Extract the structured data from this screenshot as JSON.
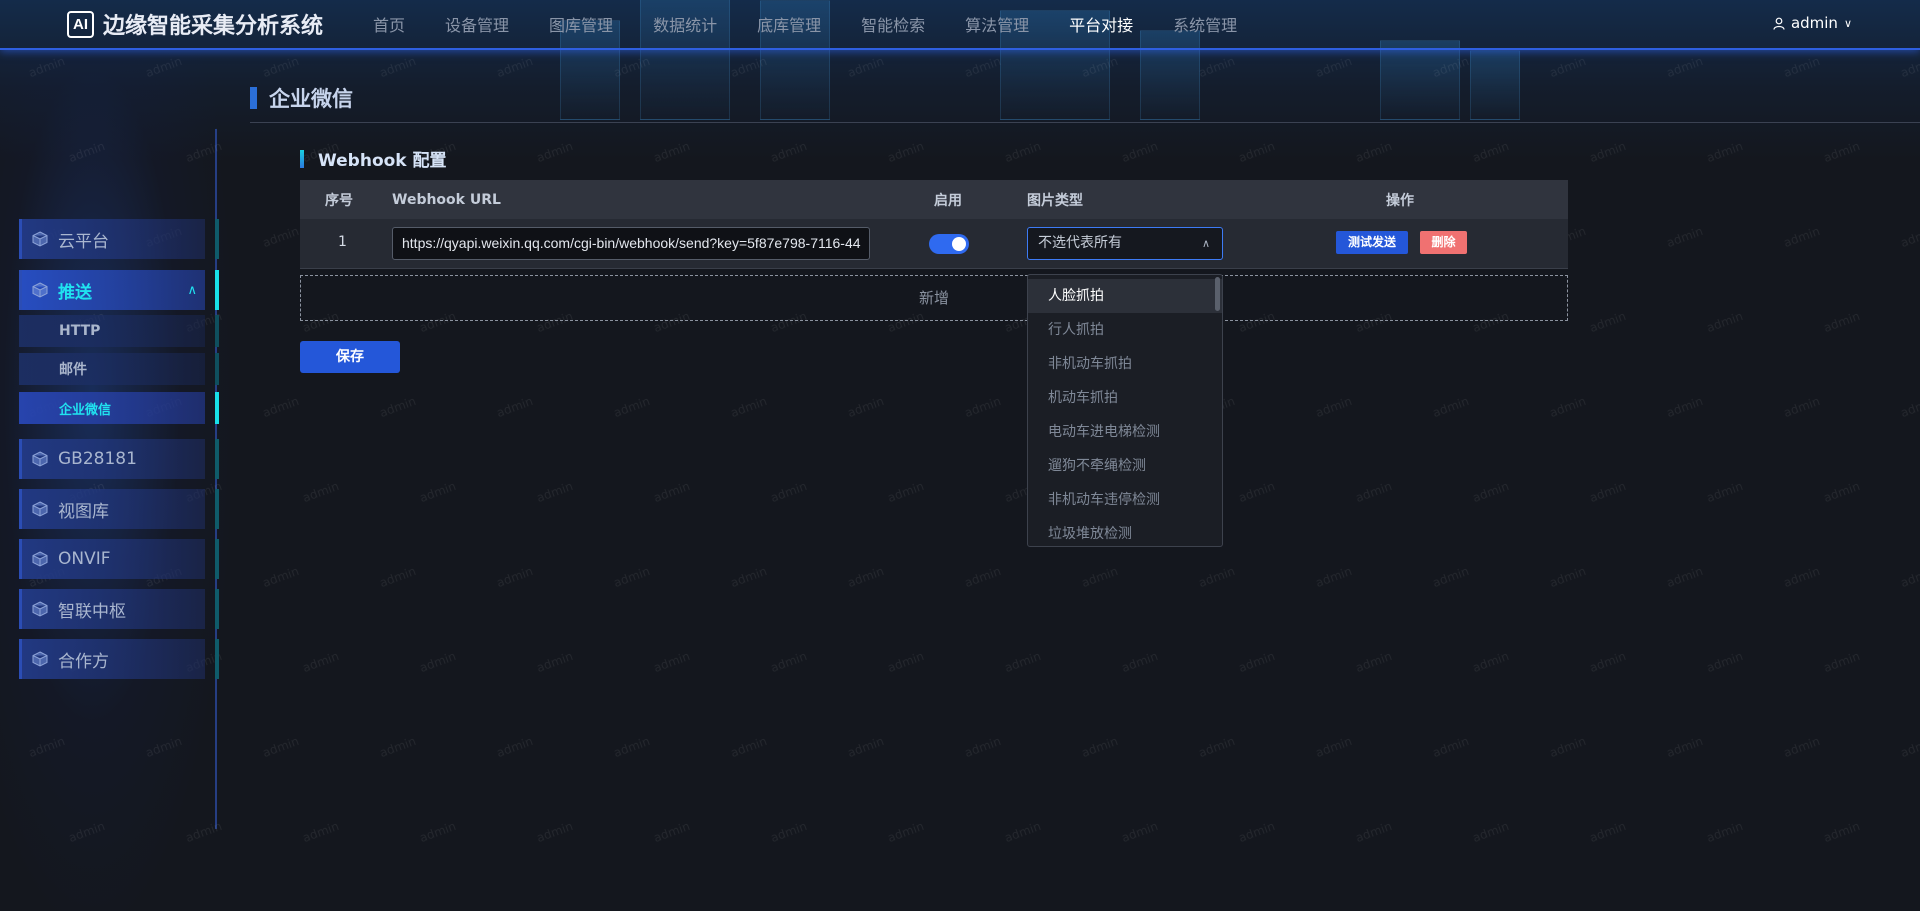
{
  "app": {
    "logo_text": "AI",
    "title": "边缘智能采集分析系统"
  },
  "nav": {
    "items": [
      "首页",
      "设备管理",
      "图库管理",
      "数据统计",
      "底库管理",
      "智能检索",
      "算法管理",
      "平台对接",
      "系统管理"
    ],
    "active": "平台对接"
  },
  "user": {
    "name": "admin"
  },
  "watermark": "admin",
  "sidebar": {
    "items": [
      {
        "label": "云平台"
      },
      {
        "label": "推送",
        "open": true
      },
      {
        "label": "GB28181"
      },
      {
        "label": "视图库"
      },
      {
        "label": "ONVIF"
      },
      {
        "label": "智联中枢"
      },
      {
        "label": "合作方"
      }
    ],
    "push_sub": [
      {
        "label": "HTTP"
      },
      {
        "label": "邮件"
      },
      {
        "label": "企业微信",
        "active": true
      }
    ]
  },
  "page": {
    "title": "企业微信",
    "section_title": "Webhook 配置"
  },
  "table": {
    "headers": [
      "序号",
      "Webhook URL",
      "启用",
      "图片类型",
      "操作"
    ],
    "rows": [
      {
        "index": "1",
        "url": "https://qyapi.weixin.qq.com/cgi-bin/webhook/send?key=5f87e798-7116-44",
        "enabled": true,
        "image_type": "不选代表所有",
        "test_label": "测试发送",
        "delete_label": "删除"
      }
    ],
    "add_label": "新增"
  },
  "save_label": "保存",
  "dropdown": {
    "options": [
      "人脸抓拍",
      "行人抓拍",
      "非机动车抓拍",
      "机动车抓拍",
      "电动车进电梯检测",
      "遛狗不牵绳检测",
      "非机动车违停检测",
      "垃圾堆放检测"
    ],
    "highlighted": "人脸抓拍"
  },
  "colors": {
    "accent": "#2457d9",
    "active_cyan": "#20e3f0",
    "danger": "#f07171",
    "background": "#14171e"
  }
}
